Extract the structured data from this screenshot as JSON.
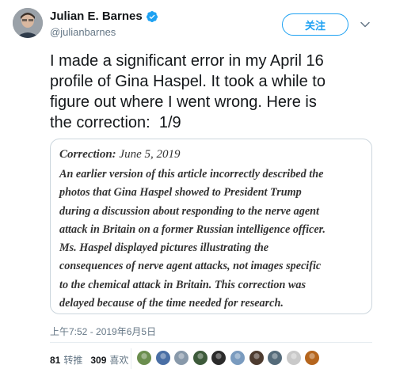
{
  "author": {
    "display_name": "Julian E. Barnes",
    "handle": "@julianbarnes",
    "verified": true,
    "avatar_icon": "profile-photo"
  },
  "follow_button": {
    "label": "关注"
  },
  "caret_icon": "chevron-down-icon",
  "tweet": {
    "text": "I made a significant error in my April 16\nprofile of Gina Haspel. It took a while to\nfigure out where I went wrong. Here is\nthe correction:  1/9"
  },
  "card": {
    "title_label": "Correction:",
    "title_date": " June 5, 2019",
    "body": "An earlier version of this article incorrectly described the\nphotos that Gina Haspel showed to President Trump\nduring a discussion about responding to the nerve agent\nattack in Britain on a former Russian intelligence officer.\nMs. Haspel displayed pictures illustrating the\nconsequences of nerve agent attacks, not images specific\nto the chemical attack in Britain. This correction was\ndelayed because of the time needed for research."
  },
  "timestamp": "上午7:52 - 2019年6月5日",
  "stats": {
    "retweets_count": "81",
    "retweets_label": "转推",
    "likes_count": "309",
    "likes_label": "喜欢"
  },
  "likers": [
    {
      "color": "#6b8e4e"
    },
    {
      "color": "#4a6fa5"
    },
    {
      "color": "#8899aa"
    },
    {
      "color": "#3d5a3a"
    },
    {
      "color": "#2b2b2b"
    },
    {
      "color": "#7a9bbf"
    },
    {
      "color": "#4d3b2f"
    },
    {
      "color": "#556b7a"
    },
    {
      "color": "#c9c9c9"
    },
    {
      "color": "#b5651d"
    }
  ],
  "colors": {
    "accent": "#1da1f2",
    "text": "#14171a",
    "muted": "#657786"
  }
}
